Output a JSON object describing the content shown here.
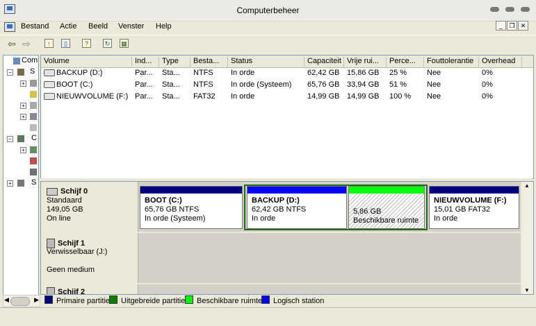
{
  "window": {
    "title": "Computerbeheer"
  },
  "menu": [
    "Bestand",
    "Actie",
    "Beeld",
    "Venster",
    "Help"
  ],
  "tree": {
    "items": [
      "Comp",
      "S",
      "C",
      "S"
    ]
  },
  "volumes": {
    "columns": [
      "Volume",
      "Ind...",
      "Type",
      "Besta...",
      "Status",
      "Capaciteit",
      "Vrije rui...",
      "Perce...",
      "Fouttolerantie",
      "Overhead"
    ],
    "rows": [
      [
        "BACKUP (D:)",
        "Par...",
        "Sta...",
        "NTFS",
        "In orde",
        "62,42 GB",
        "15,86 GB",
        "25 %",
        "Nee",
        "0%"
      ],
      [
        "BOOT (C:)",
        "Par...",
        "Sta...",
        "NTFS",
        "In orde (Systeem)",
        "65,76 GB",
        "33,94 GB",
        "51 %",
        "Nee",
        "0%"
      ],
      [
        "NIEUWVOLUME (F:)",
        "Par...",
        "Sta...",
        "FAT32",
        "In orde",
        "14,99 GB",
        "14,99 GB",
        "100 %",
        "Nee",
        "0%"
      ]
    ]
  },
  "disks": [
    {
      "name": "Schijf 0",
      "lines": [
        "Standaard",
        "149,05 GB",
        "On line"
      ]
    },
    {
      "name": "Schijf 1",
      "lines": [
        "Verwisselbaar (J:)",
        "",
        "Geen medium"
      ]
    },
    {
      "name": "Schijf 2",
      "lines": []
    }
  ],
  "partitions": [
    {
      "name": "BOOT  (C:)",
      "size": "65,76 GB NTFS",
      "status": "In orde (Systeem)",
      "color": "#000080"
    },
    {
      "name": "BACKUP  (D:)",
      "size": "62,42 GB NTFS",
      "status": "In orde",
      "color": "#0000ff"
    },
    {
      "name": "",
      "size": "5,86 GB",
      "status": "Beschikbare ruimte",
      "color": "#00ff00"
    },
    {
      "name": "NIEUWVOLUME  (F:)",
      "size": "15,01 GB FAT32",
      "status": "In orde",
      "color": "#000080"
    }
  ],
  "legend": [
    {
      "label": "Primaire partitie",
      "color": "#000080"
    },
    {
      "label": "Uitgebreide partitie",
      "color": "#008000"
    },
    {
      "label": "Beschikbare ruimte",
      "color": "#00ff00"
    },
    {
      "label": "Logisch station",
      "color": "#0000ff"
    }
  ]
}
